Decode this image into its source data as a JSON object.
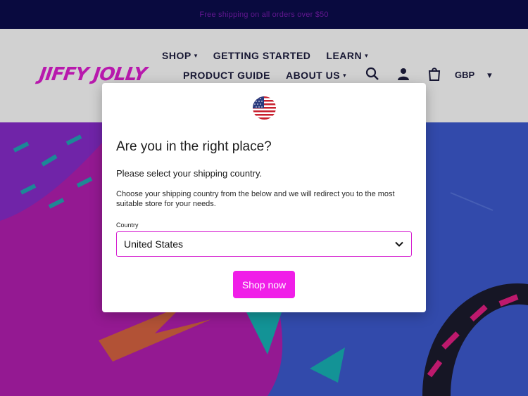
{
  "announcement": {
    "text": "Free shipping on all orders over $50"
  },
  "header": {
    "logo": "JIFFY JOLLY",
    "nav_row1": [
      {
        "label": "SHOP",
        "has_dropdown": true
      },
      {
        "label": "GETTING STARTED",
        "has_dropdown": false
      },
      {
        "label": "LEARN",
        "has_dropdown": true
      }
    ],
    "nav_row2": [
      {
        "label": "PRODUCT GUIDE",
        "has_dropdown": false
      },
      {
        "label": "ABOUT US",
        "has_dropdown": true
      }
    ],
    "icons": [
      "search-icon",
      "account-icon",
      "cart-icon"
    ],
    "currency": "GBP"
  },
  "modal": {
    "title": "Are you in the right place?",
    "subtitle": "Please select your shipping country.",
    "description": "Choose your shipping country from the below and we will redirect you to the most suitable store for your needs.",
    "country_label": "Country",
    "country_value": "United States",
    "button": "Shop now",
    "flag": "us-flag-icon"
  },
  "colors": {
    "accent": "#f01ee8",
    "announce_bg": "#0c0d4e",
    "select_border": "#d51fd0"
  }
}
